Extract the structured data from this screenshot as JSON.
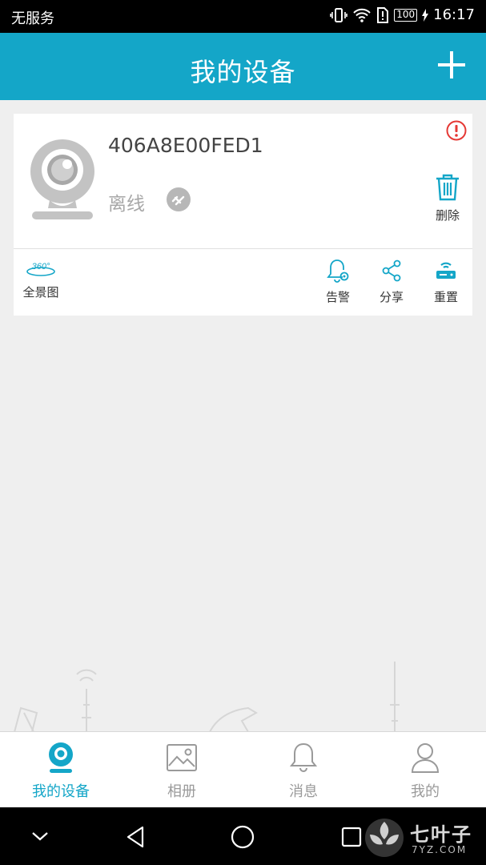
{
  "status_bar": {
    "carrier": "无服务",
    "battery": "100",
    "time": "16:17"
  },
  "header": {
    "title": "我的设备",
    "add_icon": "plus-icon"
  },
  "device": {
    "id": "406A8E00FED1",
    "status": "离线",
    "delete_label": "删除",
    "panorama_badge": "360°",
    "actions": {
      "panorama": "全景图",
      "alarm": "告警",
      "share": "分享",
      "reset": "重置"
    }
  },
  "tabs": [
    {
      "label": "我的设备",
      "icon": "camera-icon",
      "active": true
    },
    {
      "label": "相册",
      "icon": "photo-album-icon",
      "active": false
    },
    {
      "label": "消息",
      "icon": "bell-icon",
      "active": false
    },
    {
      "label": "我的",
      "icon": "user-icon",
      "active": false
    }
  ],
  "watermark": {
    "name": "七叶子",
    "url": "7YZ.COM"
  },
  "colors": {
    "accent": "#14a6c8",
    "warning": "#e53935",
    "muted": "#a7a7a7"
  }
}
